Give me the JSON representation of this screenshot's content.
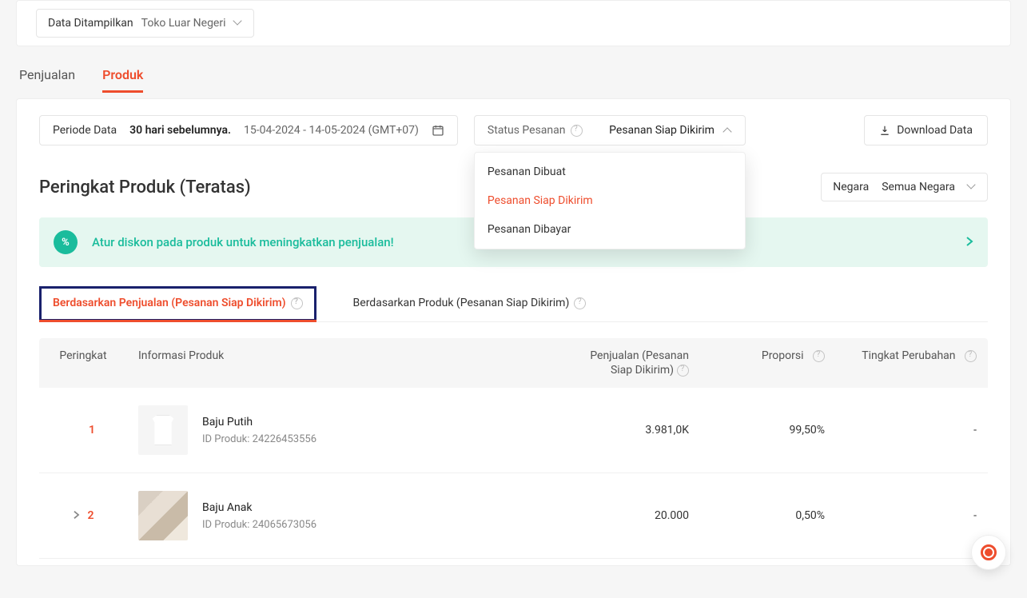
{
  "display": {
    "label": "Data Ditampilkan",
    "value": "Toko Luar Negeri"
  },
  "mainTabs": {
    "sales": "Penjualan",
    "product": "Produk"
  },
  "period": {
    "label": "Periode Data",
    "preset": "30 hari sebelumnya.",
    "range": "15-04-2024 - 14-05-2024 (GMT+07)"
  },
  "status": {
    "label": "Status Pesanan",
    "value": "Pesanan Siap Dikirim",
    "options": {
      "created": "Pesanan Dibuat",
      "ready": "Pesanan Siap Dikirim",
      "paid": "Pesanan Dibayar"
    }
  },
  "download": "Download Data",
  "sectionTitle": "Peringkat Produk (Teratas)",
  "country": {
    "label": "Negara",
    "value": "Semua Negara"
  },
  "banner": "Atur diskon pada produk untuk meningkatkan penjualan!",
  "subTabs": {
    "bySales": "Berdasarkan Penjualan (Pesanan Siap Dikirim)",
    "byProduct": "Berdasarkan Produk (Pesanan Siap Dikirim)"
  },
  "columns": {
    "rank": "Peringkat",
    "info": "Informasi Produk",
    "sales_l1": "Penjualan (Pesanan",
    "sales_l2": "Siap Dikirim)",
    "prop": "Proporsi",
    "change": "Tingkat Perubahan"
  },
  "idPrefix": "ID Produk: ",
  "rows": [
    {
      "rank": "1",
      "name": "Baju Putih",
      "id": "24226453556",
      "sales": "3.981,0K",
      "prop": "99,50%",
      "change": "-",
      "expandable": false
    },
    {
      "rank": "2",
      "name": "Baju Anak",
      "id": "24065673056",
      "sales": "20.000",
      "prop": "0,50%",
      "change": "-",
      "expandable": true
    }
  ]
}
